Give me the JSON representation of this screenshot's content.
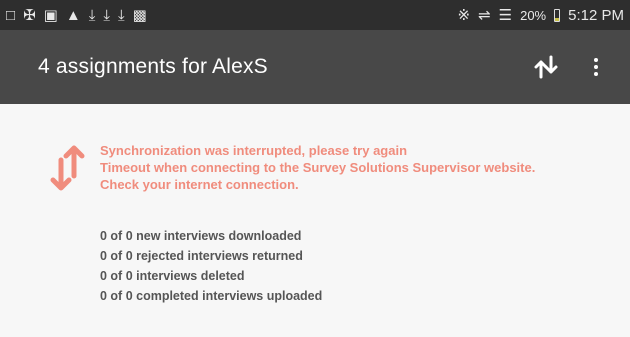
{
  "status_bar": {
    "icons_left": [
      "screen-icon",
      "shield-icon",
      "image-icon",
      "warning-icon",
      "download-icon",
      "download-icon",
      "download-icon",
      "briefcase-icon"
    ],
    "icons_right": [
      "bluetooth-icon",
      "mute-icon",
      "wifi-icon"
    ],
    "battery": "20%",
    "time": "5:12 PM"
  },
  "app_bar": {
    "title": "4 assignments for AlexS",
    "actions": [
      "sync-icon",
      "more-vert-icon"
    ]
  },
  "sync_result": {
    "error_lines": [
      "Synchronization was interrupted, please try again",
      "Timeout when connecting to the Survey Solutions Supervisor website.",
      "Check your internet connection."
    ],
    "stats": [
      "0 of 0 new interviews downloaded",
      "0 of 0 rejected interviews returned",
      "0 of 0 interviews deleted",
      "0 of 0 completed interviews uploaded"
    ],
    "accent_color": "#f08c7d"
  }
}
